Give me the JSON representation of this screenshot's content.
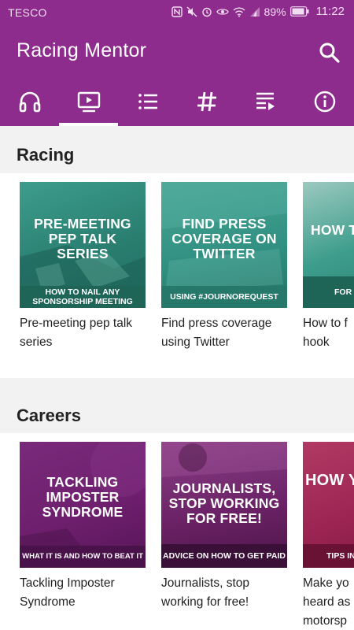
{
  "status_bar": {
    "carrier": "TESCO",
    "battery": "89%",
    "time": "11:22"
  },
  "app": {
    "title": "Racing Mentor"
  },
  "tabs": [
    {
      "icon": "headphones-icon"
    },
    {
      "icon": "video-icon",
      "active": true
    },
    {
      "icon": "list-icon"
    },
    {
      "icon": "hashtag-icon"
    },
    {
      "icon": "playlist-icon"
    },
    {
      "icon": "info-icon"
    }
  ],
  "sections": [
    {
      "title": "Racing",
      "cards": [
        {
          "headline": "PRE-MEETING PEP TALK SERIES",
          "band": "HOW TO NAIL ANY SPONSORSHIP MEETING",
          "caption": "Pre-meeting pep talk series"
        },
        {
          "headline": "FIND PRESS COVERAGE ON TWITTER",
          "band": "USING #JOURNOREQUEST",
          "caption": "Find press coverage using Twitter"
        },
        {
          "headline": "HOW TO F YOU",
          "band": "FOR AND M",
          "caption": "How to f hook"
        }
      ]
    },
    {
      "title": "Careers",
      "cards": [
        {
          "headline": "TACKLING IMPOSTER SYNDROME",
          "band": "WHAT IT IS AND HOW TO BEAT IT",
          "caption": "Tackling Imposter Syndrome"
        },
        {
          "headline": "JOURNALISTS, STOP WORKING FOR FREE!",
          "band": "ADVICE ON HOW TO GET PAID",
          "caption": "Journalists, stop working for free!"
        },
        {
          "headline": "HOW YOU H",
          "band": "TIPS IN M",
          "caption": "Make yo heard as motorsp"
        }
      ]
    }
  ],
  "colors": {
    "primary": "#8e2c8e",
    "racing_teal": "#2f8f80",
    "careers_purple": "#6e1f6e",
    "careers_pink": "#9c2452"
  }
}
